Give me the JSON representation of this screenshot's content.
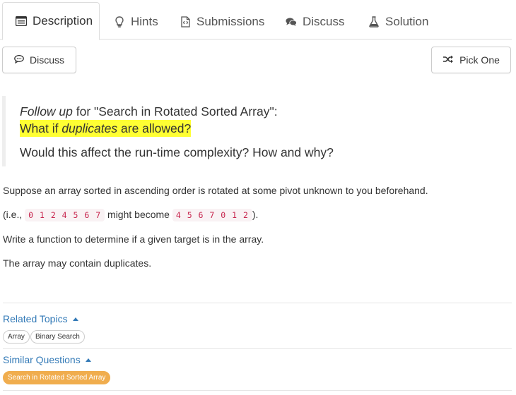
{
  "tabs": [
    {
      "label": "Description",
      "icon": "description-icon"
    },
    {
      "label": "Hints",
      "icon": "lightbulb-icon"
    },
    {
      "label": "Submissions",
      "icon": "submissions-icon"
    },
    {
      "label": "Discuss",
      "icon": "comments-icon"
    },
    {
      "label": "Solution",
      "icon": "flask-icon"
    }
  ],
  "toolbar": {
    "discuss_label": "Discuss",
    "pick_one_label": "Pick One"
  },
  "followup": {
    "follow_up": "Follow up",
    "for_text": " for \"Search in Rotated Sorted Array\":",
    "what_if": "What if ",
    "duplicates": "duplicates",
    "are_allowed": " are allowed?",
    "question": "Would this affect the run-time complexity? How and why?"
  },
  "description": {
    "p1": "Suppose an array sorted in ascending order is rotated at some pivot unknown to you beforehand.",
    "p2_prefix": "(i.e., ",
    "code1": "0 1 2 4 5 6 7",
    "p2_middle": " might become ",
    "code2": "4 5 6 7 0 1 2",
    "p2_suffix": ").",
    "p3": "Write a function to determine if a given target is in the array.",
    "p4": "The array may contain duplicates."
  },
  "related_topics": {
    "title": "Related Topics",
    "tags": [
      "Array",
      "Binary Search"
    ]
  },
  "similar_questions": {
    "title": "Similar Questions",
    "tags": [
      "Search in Rotated Sorted Array"
    ]
  },
  "colors": {
    "link": "#337ab7",
    "highlight": "#ffff33",
    "code": "#c7254e",
    "tag_orange": "#f0ad4e"
  }
}
